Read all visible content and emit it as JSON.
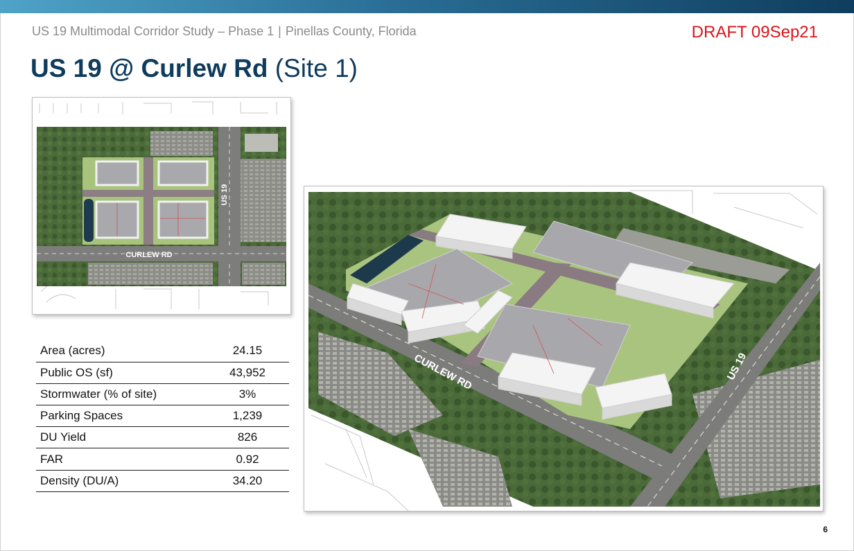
{
  "header": {
    "subtitle_left": "US 19 Multimodal Corridor Study – Phase 1",
    "subtitle_sep": "|",
    "subtitle_right": "Pinellas County, Florida",
    "draft_label": "DRAFT 09Sep21",
    "title_bold": "US 19 @ Curlew Rd",
    "title_normal": "(Site 1)"
  },
  "plan_image": {
    "road_label_1": "US 19",
    "road_label_2": "CURLEW RD"
  },
  "perspective_image": {
    "road_label_1": "CURLEW RD",
    "road_label_2": "US 19"
  },
  "metrics": [
    {
      "label": "Area (acres)",
      "value": "24.15"
    },
    {
      "label": "Public OS (sf)",
      "value": "43,952"
    },
    {
      "label": "Stormwater (% of site)",
      "value": "3%"
    },
    {
      "label": "Parking Spaces",
      "value": "1,239"
    },
    {
      "label": "DU Yield",
      "value": "826"
    },
    {
      "label": "FAR",
      "value": "0.92"
    },
    {
      "label": "Density (DU/A)",
      "value": "34.20"
    }
  ],
  "footer": {
    "page_number": "6"
  },
  "colors": {
    "title": "#0f3b5c",
    "draft": "#d8141a",
    "subtitle": "#8a8a8a",
    "band_start": "#4fa3c8",
    "band_end": "#0f3d5e"
  }
}
